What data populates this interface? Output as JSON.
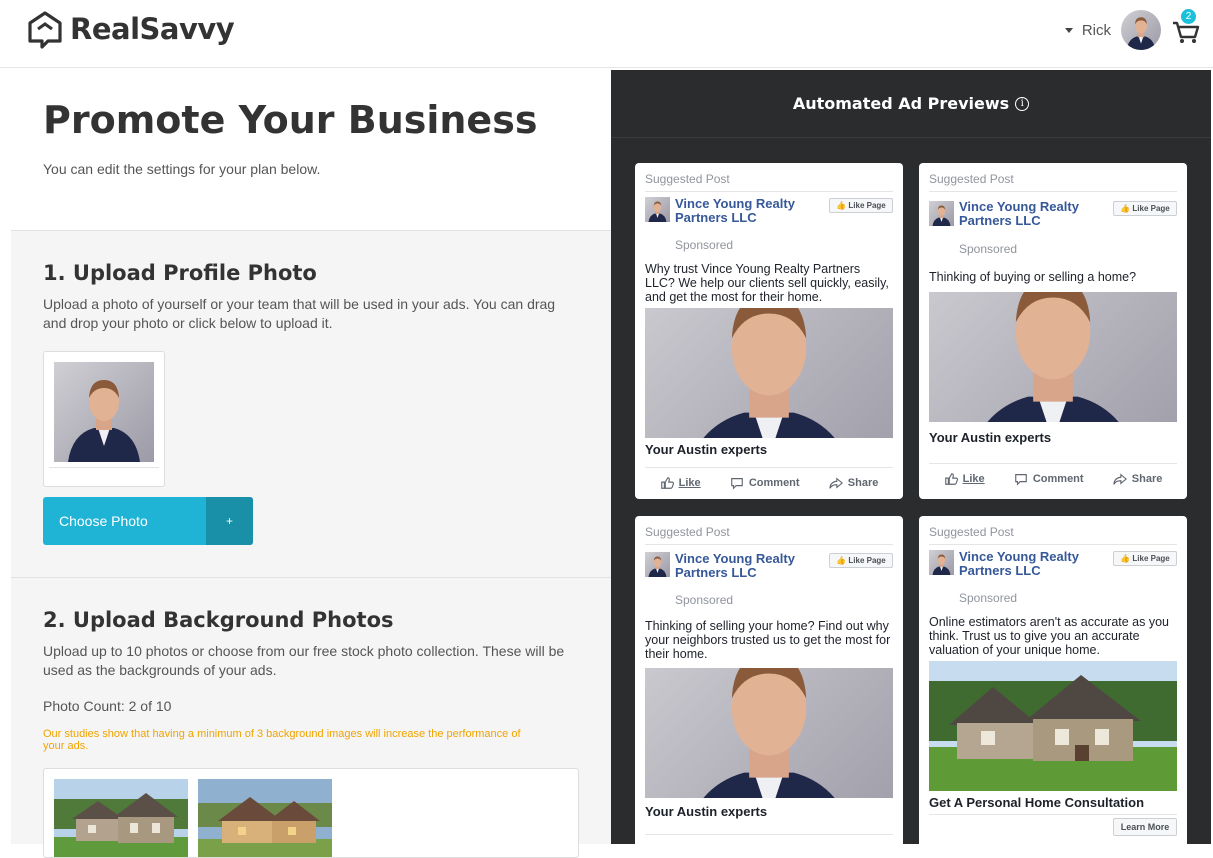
{
  "brand": {
    "name": "RealSavvy"
  },
  "header": {
    "user_name": "Rick",
    "cart_count": "2"
  },
  "page": {
    "title": "Promote Your Business",
    "subtitle": "You can edit the settings for your plan below."
  },
  "section1": {
    "title": "1. Upload Profile Photo",
    "text": "Upload a photo of yourself or your team that will be used in your ads. You can drag and drop your photo or click below to upload it.",
    "button_label": "Choose Photo",
    "button_plus": "+"
  },
  "section2": {
    "title": "2. Upload Background Photos",
    "text": "Upload up to 10 photos or choose from our free stock photo collection. These will be used as the backgrounds of your ads.",
    "count": "Photo Count: 2 of 10",
    "hint": "Our studies show that having a minimum of 3 background images will increase the performance of your ads."
  },
  "previews": {
    "title": "Automated Ad Previews",
    "info_icon": "info-icon",
    "cards": [
      {
        "suggested": "Suggested Post",
        "page_name": "Vince Young Realty Partners LLC",
        "sponsored": "Sponsored",
        "like_page": "Like Page",
        "body": "Why trust Vince Young Realty Partners LLC? We help our clients sell quickly, easily, and get the most for their home.",
        "headline": "Your Austin experts",
        "actions": [
          "Like",
          "Comment",
          "Share"
        ]
      },
      {
        "suggested": "Suggested Post",
        "page_name": "Vince Young Realty Partners LLC",
        "sponsored": "Sponsored",
        "like_page": "Like Page",
        "body": "Thinking of buying or selling a home?",
        "headline": "Your Austin experts",
        "actions": [
          "Like",
          "Comment",
          "Share"
        ]
      },
      {
        "suggested": "Suggested Post",
        "page_name": "Vince Young Realty Partners LLC",
        "sponsored": "Sponsored",
        "like_page": "Like Page",
        "body": "Thinking of selling your home? Find out why your neighbors trusted us to get the most for their home.",
        "headline": "Your Austin experts"
      },
      {
        "suggested": "Suggested Post",
        "page_name": "Vince Young Realty Partners LLC",
        "sponsored": "Sponsored",
        "like_page": "Like Page",
        "body": "Online estimators aren't as accurate as you think. Trust us to give you an accurate valuation of your unique home.",
        "headline": "Get A Personal Home Consultation",
        "cta": "Learn More"
      }
    ]
  }
}
